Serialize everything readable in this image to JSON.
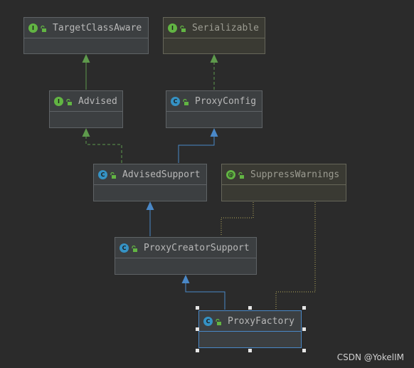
{
  "diagram": {
    "nodes": [
      {
        "id": "TargetClassAware",
        "kind": "interface",
        "badge": "I",
        "label": "TargetClassAware"
      },
      {
        "id": "Serializable",
        "kind": "interface",
        "badge": "I",
        "label": "Serializable"
      },
      {
        "id": "Advised",
        "kind": "interface",
        "badge": "I",
        "label": "Advised"
      },
      {
        "id": "ProxyConfig",
        "kind": "class",
        "badge": "C",
        "label": "ProxyConfig"
      },
      {
        "id": "AdvisedSupport",
        "kind": "class",
        "badge": "C",
        "label": "AdvisedSupport"
      },
      {
        "id": "SuppressWarnings",
        "kind": "annotation",
        "badge": "@",
        "label": "SuppressWarnings"
      },
      {
        "id": "ProxyCreatorSupport",
        "kind": "class",
        "badge": "C",
        "label": "ProxyCreatorSupport"
      },
      {
        "id": "ProxyFactory",
        "kind": "class",
        "badge": "C",
        "label": "ProxyFactory"
      }
    ],
    "edges": [
      {
        "from": "Advised",
        "to": "TargetClassAware",
        "type": "extends-interface"
      },
      {
        "from": "ProxyConfig",
        "to": "Serializable",
        "type": "implements"
      },
      {
        "from": "AdvisedSupport",
        "to": "Advised",
        "type": "implements"
      },
      {
        "from": "AdvisedSupport",
        "to": "ProxyConfig",
        "type": "extends"
      },
      {
        "from": "ProxyCreatorSupport",
        "to": "AdvisedSupport",
        "type": "extends"
      },
      {
        "from": "ProxyFactory",
        "to": "ProxyCreatorSupport",
        "type": "extends"
      },
      {
        "from": "SuppressWarnings",
        "to": "ProxyFactory",
        "type": "annotation"
      }
    ],
    "selected": "ProxyFactory",
    "colors": {
      "background": "#2b2b2b",
      "interface_badge": "#62b543",
      "class_badge": "#3592c4",
      "implements_edge": "#5e9a4c",
      "extends_edge": "#4a88c7",
      "annotation_edge": "#b8ad5c"
    }
  },
  "watermark": "CSDN @YokelIM"
}
